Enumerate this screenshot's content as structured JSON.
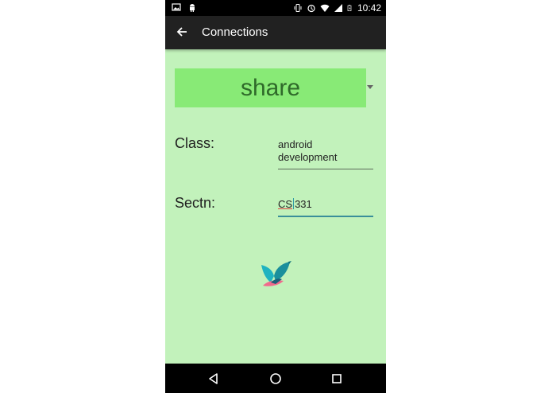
{
  "status_bar": {
    "time": "10:42",
    "left_icons": [
      "image-icon",
      "android-icon"
    ],
    "right_icons": [
      "vibrate-icon",
      "alarm-icon",
      "wifi-icon",
      "signal-icon",
      "battery-icon"
    ]
  },
  "app_bar": {
    "title": "Connections",
    "back_icon": "arrow-back-icon"
  },
  "spinner": {
    "selected": "share"
  },
  "form": {
    "class_label": "Class:",
    "class_value_line1": "android",
    "class_value_line2": "development",
    "section_label": "Sectn:",
    "section_value_part1": "CS",
    "section_value_part2": "331"
  },
  "logo": {
    "icon": "bird-logo-icon"
  },
  "nav_bar": {
    "icons": [
      "nav-back-icon",
      "nav-home-icon",
      "nav-recent-icon"
    ]
  },
  "colors": {
    "background": "#c2f2bb",
    "spinner_bg": "#88ea76",
    "spinner_text": "#2f6a2a",
    "app_bar": "#212121",
    "accent": "#3a8f9a"
  }
}
